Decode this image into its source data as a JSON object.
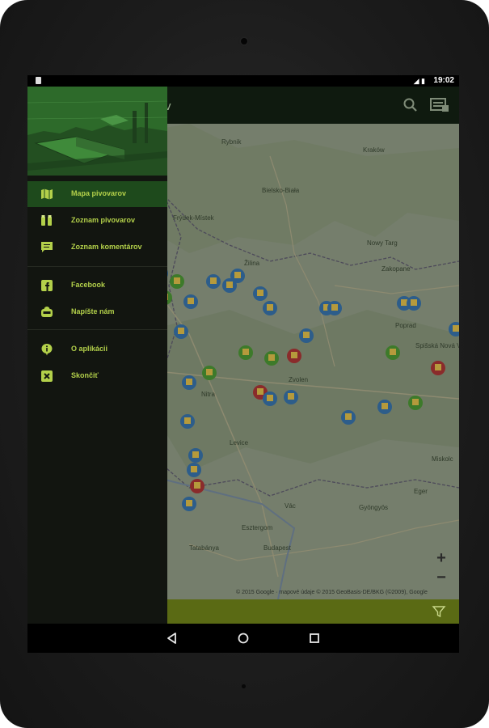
{
  "status_bar": {
    "time": "19:02"
  },
  "app": {
    "title_fragment": "v"
  },
  "drawer": {
    "items_group1": [
      {
        "label": "Mapa pivovarov",
        "icon": "map-icon",
        "active": true
      },
      {
        "label": "Zoznam pivovarov",
        "icon": "beer-list-icon",
        "active": false
      },
      {
        "label": "Zoznam komentárov",
        "icon": "comment-icon",
        "active": false
      }
    ],
    "items_group2": [
      {
        "label": "Facebook",
        "icon": "facebook-icon"
      },
      {
        "label": "Napíšte nám",
        "icon": "mail-icon"
      }
    ],
    "items_group3": [
      {
        "label": "O aplikácii",
        "icon": "info-icon"
      },
      {
        "label": "Skončiť",
        "icon": "exit-icon"
      }
    ]
  },
  "map": {
    "labels": [
      "Rybnik",
      "Kraków",
      "Bielsko-Biała",
      "Nowy Targ",
      "Zakopane",
      "Frýdek-Místek",
      "Poprad",
      "Spišská Nová Ves",
      "Nitra",
      "Levice",
      "Budapest",
      "Vác",
      "Eger",
      "Gyöngyös",
      "Tatabánya",
      "Esztergom",
      "Miskolc",
      "Zvolen",
      "Žilina"
    ],
    "zoom_in": "+",
    "zoom_out": "−",
    "copyright": "© 2015 Google · mapové údaje © 2015 GeoBasis-DE/BKG (©2009), Google"
  },
  "colors": {
    "accent": "#b3d04a",
    "drawer_bg": "#121510",
    "active_bg": "#1e4a1c",
    "bottom_bar": "#5a6a14"
  }
}
